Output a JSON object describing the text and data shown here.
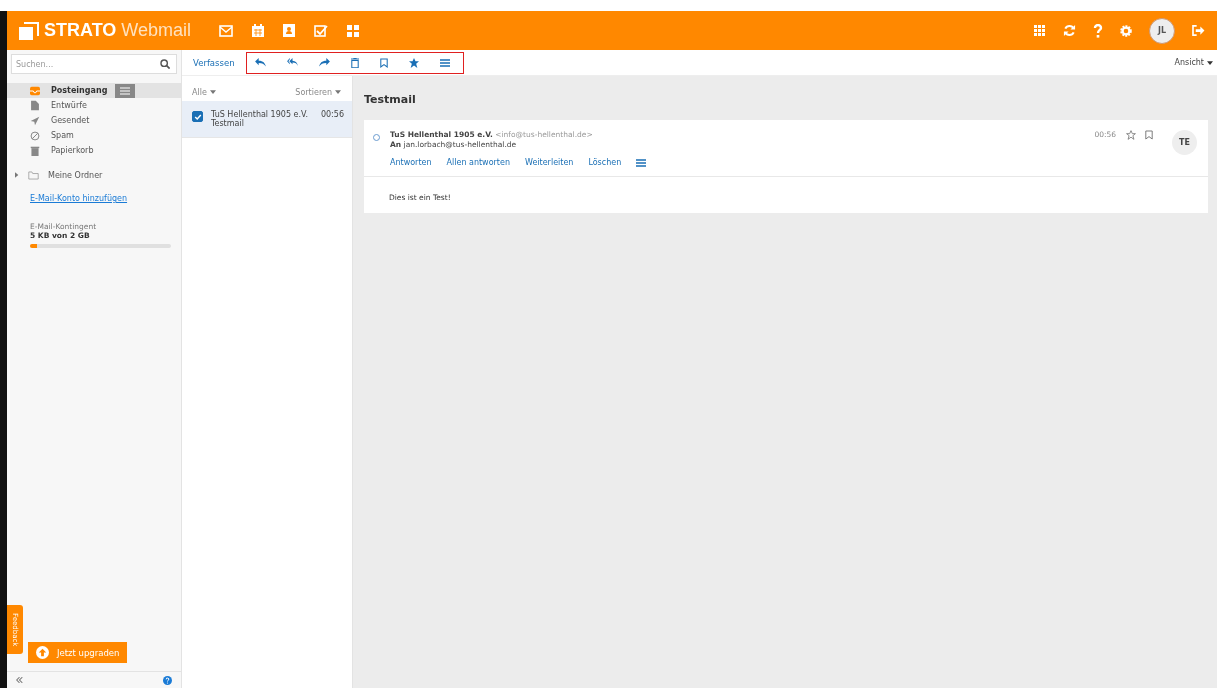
{
  "header": {
    "brand": "STRATO",
    "product": "Webmail",
    "avatar": "JL"
  },
  "search": {
    "placeholder": "Suchen..."
  },
  "folders": [
    {
      "label": "Posteingang",
      "kind": "inbox",
      "selected": true
    },
    {
      "label": "Entwürfe",
      "kind": "drafts",
      "selected": false
    },
    {
      "label": "Gesendet",
      "kind": "sent",
      "selected": false
    },
    {
      "label": "Spam",
      "kind": "spam",
      "selected": false
    },
    {
      "label": "Papierkorb",
      "kind": "trash",
      "selected": false
    }
  ],
  "my_folders": {
    "label": "Meine Ordner",
    "expanded": false
  },
  "add_account": "E-Mail-Konto hinzufügen",
  "quota": {
    "label": "E-Mail-Kontingent",
    "reading": "5 KB von 2 GB",
    "level": 0.05
  },
  "feedback": "Feedback",
  "upgrade": "Jetzt upgraden",
  "toolbar": {
    "compose": "Verfassen",
    "view": "Ansicht"
  },
  "list": {
    "filter": "Alle",
    "sort": "Sortieren",
    "messages": [
      {
        "sender": "TuS Hellenthal 1905 e.V.",
        "subject": "Testmail",
        "time": "00:56",
        "checked": true,
        "selected": true
      }
    ]
  },
  "message": {
    "subject": "Testmail",
    "sender": "TuS Hellenthal 1905 e.V.",
    "sender_address": "<info@tus-hellenthal.de>",
    "to_label": "An",
    "to": "jan.lorbach@tus-hellenthal.de",
    "time": "00:56",
    "unread": false,
    "avatar": "TE",
    "actions": [
      "Antworten",
      "Allen antworten",
      "Weiterleiten",
      "Löschen"
    ],
    "body": "Dies ist ein Test!"
  }
}
